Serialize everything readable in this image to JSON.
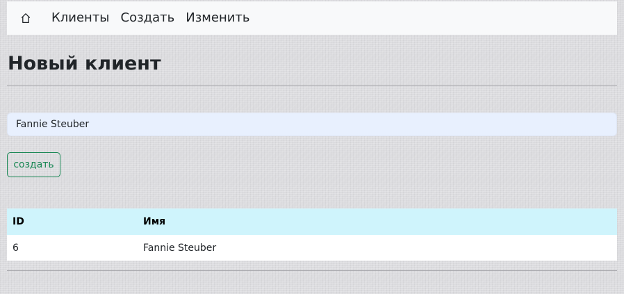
{
  "colors": {
    "navbar_bg": "#f8f9fa",
    "input_bg": "#e8f0fe",
    "button_accent": "#198754",
    "table_header_bg": "#cff4fc"
  },
  "navbar": {
    "home_icon": "house-icon",
    "links": [
      {
        "label": "Клиенты"
      },
      {
        "label": "Создать"
      },
      {
        "label": "Изменить"
      }
    ]
  },
  "page": {
    "title": "Новый клиент"
  },
  "form": {
    "name_value": "Fannie Steuber",
    "submit_label": "создать"
  },
  "table": {
    "headers": [
      "ID",
      "Имя"
    ],
    "rows": [
      [
        "6",
        "Fannie Steuber"
      ]
    ]
  }
}
